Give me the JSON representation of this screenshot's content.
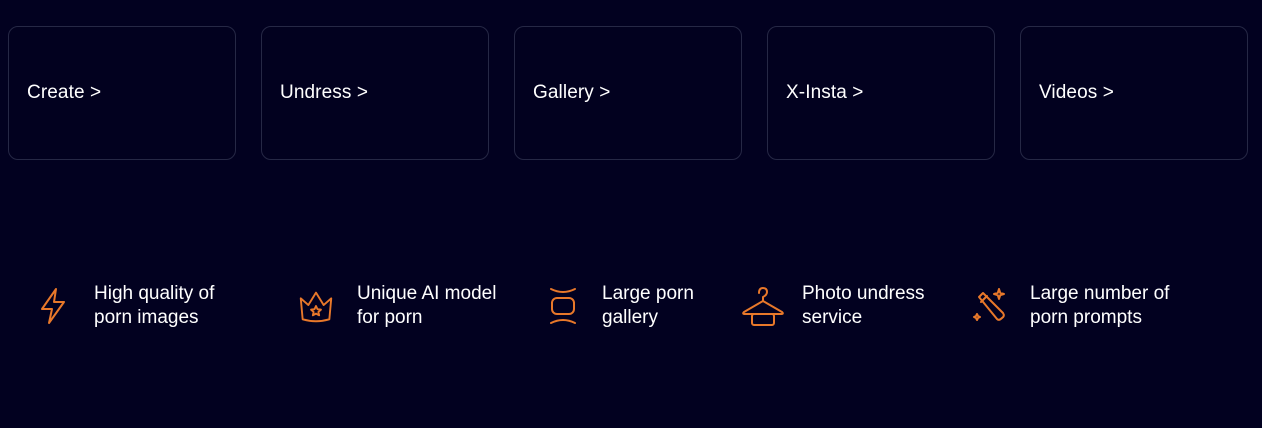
{
  "nav_cards": [
    {
      "label": "Create >"
    },
    {
      "label": "Undress >"
    },
    {
      "label": "Gallery >"
    },
    {
      "label": "X-Insta >"
    },
    {
      "label": "Videos >"
    }
  ],
  "features": [
    {
      "icon": "lightning-icon",
      "line1": "High quality of",
      "line2": "porn images"
    },
    {
      "icon": "crown-icon",
      "line1": "Unique AI model",
      "line2": "for porn"
    },
    {
      "icon": "gallery-frame-icon",
      "line1": "Large porn",
      "line2": "gallery"
    },
    {
      "icon": "hanger-icon",
      "line1": "Photo undress",
      "line2": "service"
    },
    {
      "icon": "magic-wand-icon",
      "line1": "Large number of",
      "line2": "porn prompts"
    }
  ],
  "colors": {
    "background": "#020120",
    "card_border": "#262845",
    "accent": "#E8782A",
    "text": "#FFFFFF"
  }
}
